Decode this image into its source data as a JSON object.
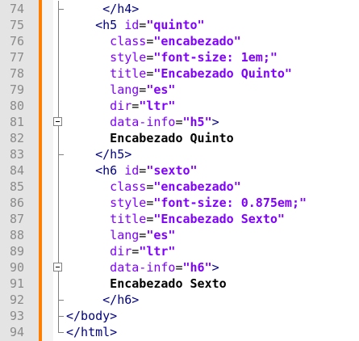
{
  "editor": {
    "lines": [
      {
        "num": "74",
        "fold": "end-sub",
        "indent": 5,
        "parts": [
          {
            "t": "tag",
            "v": "</h4>"
          }
        ]
      },
      {
        "num": "75",
        "fold": "line",
        "indent": 4,
        "parts": [
          {
            "t": "tag",
            "v": "<h5 "
          },
          {
            "t": "attr",
            "v": "id"
          },
          {
            "t": "eq",
            "v": "="
          },
          {
            "t": "str",
            "v": "\"quinto\""
          }
        ]
      },
      {
        "num": "76",
        "fold": "line",
        "indent": 6,
        "parts": [
          {
            "t": "attr",
            "v": "class"
          },
          {
            "t": "eq",
            "v": "="
          },
          {
            "t": "str",
            "v": "\"encabezado\""
          }
        ]
      },
      {
        "num": "77",
        "fold": "line",
        "indent": 6,
        "parts": [
          {
            "t": "attr",
            "v": "style"
          },
          {
            "t": "eq",
            "v": "="
          },
          {
            "t": "str",
            "v": "\"font-size: 1em;\""
          }
        ]
      },
      {
        "num": "78",
        "fold": "line",
        "indent": 6,
        "parts": [
          {
            "t": "attr",
            "v": "title"
          },
          {
            "t": "eq",
            "v": "="
          },
          {
            "t": "str",
            "v": "\"Encabezado Quinto\""
          }
        ]
      },
      {
        "num": "79",
        "fold": "line",
        "indent": 6,
        "parts": [
          {
            "t": "attr",
            "v": "lang"
          },
          {
            "t": "eq",
            "v": "="
          },
          {
            "t": "str",
            "v": "\"es\""
          }
        ]
      },
      {
        "num": "80",
        "fold": "line",
        "indent": 6,
        "parts": [
          {
            "t": "attr",
            "v": "dir"
          },
          {
            "t": "eq",
            "v": "="
          },
          {
            "t": "str",
            "v": "\"ltr\""
          }
        ]
      },
      {
        "num": "81",
        "fold": "box",
        "indent": 6,
        "parts": [
          {
            "t": "attr",
            "v": "data-info"
          },
          {
            "t": "eq",
            "v": "="
          },
          {
            "t": "str",
            "v": "\"h5\""
          },
          {
            "t": "tag",
            "v": ">"
          }
        ]
      },
      {
        "num": "82",
        "fold": "line",
        "indent": 6,
        "parts": [
          {
            "t": "txt",
            "v": "Encabezado Quinto"
          }
        ]
      },
      {
        "num": "83",
        "fold": "end-sub",
        "indent": 4,
        "parts": [
          {
            "t": "tag",
            "v": "</h5>"
          }
        ]
      },
      {
        "num": "84",
        "fold": "line",
        "indent": 4,
        "parts": [
          {
            "t": "tag",
            "v": "<h6 "
          },
          {
            "t": "attr",
            "v": "id"
          },
          {
            "t": "eq",
            "v": "="
          },
          {
            "t": "str",
            "v": "\"sexto\""
          }
        ]
      },
      {
        "num": "85",
        "fold": "line",
        "indent": 6,
        "parts": [
          {
            "t": "attr",
            "v": "class"
          },
          {
            "t": "eq",
            "v": "="
          },
          {
            "t": "str",
            "v": "\"encabezado\""
          }
        ]
      },
      {
        "num": "86",
        "fold": "line",
        "indent": 6,
        "parts": [
          {
            "t": "attr",
            "v": "style"
          },
          {
            "t": "eq",
            "v": "="
          },
          {
            "t": "str",
            "v": "\"font-size: 0.875em;\""
          }
        ]
      },
      {
        "num": "87",
        "fold": "line",
        "indent": 6,
        "parts": [
          {
            "t": "attr",
            "v": "title"
          },
          {
            "t": "eq",
            "v": "="
          },
          {
            "t": "str",
            "v": "\"Encabezado Sexto\""
          }
        ]
      },
      {
        "num": "88",
        "fold": "line",
        "indent": 6,
        "parts": [
          {
            "t": "attr",
            "v": "lang"
          },
          {
            "t": "eq",
            "v": "="
          },
          {
            "t": "str",
            "v": "\"es\""
          }
        ]
      },
      {
        "num": "89",
        "fold": "line",
        "indent": 6,
        "parts": [
          {
            "t": "attr",
            "v": "dir"
          },
          {
            "t": "eq",
            "v": "="
          },
          {
            "t": "str",
            "v": "\"ltr\""
          }
        ]
      },
      {
        "num": "90",
        "fold": "box",
        "indent": 6,
        "parts": [
          {
            "t": "attr",
            "v": "data-info"
          },
          {
            "t": "eq",
            "v": "="
          },
          {
            "t": "str",
            "v": "\"h6\""
          },
          {
            "t": "tag",
            "v": ">"
          }
        ]
      },
      {
        "num": "91",
        "fold": "line",
        "indent": 6,
        "parts": [
          {
            "t": "txt",
            "v": "Encabezado Sexto"
          }
        ]
      },
      {
        "num": "92",
        "fold": "end-sub",
        "indent": 5,
        "parts": [
          {
            "t": "tag",
            "v": "</h6>"
          }
        ]
      },
      {
        "num": "93",
        "fold": "end-sub",
        "indent": 0,
        "parts": [
          {
            "t": "tag",
            "v": "</body>"
          }
        ]
      },
      {
        "num": "94",
        "fold": "end",
        "indent": 0,
        "parts": [
          {
            "t": "tag",
            "v": "</html>"
          }
        ]
      }
    ]
  },
  "colors": {
    "tag": "#000080",
    "attribute": "#8000ff",
    "string": "#8000ff",
    "text": "#000000",
    "line_number": "#8a8a8a",
    "change_bar": "#ff8000"
  }
}
